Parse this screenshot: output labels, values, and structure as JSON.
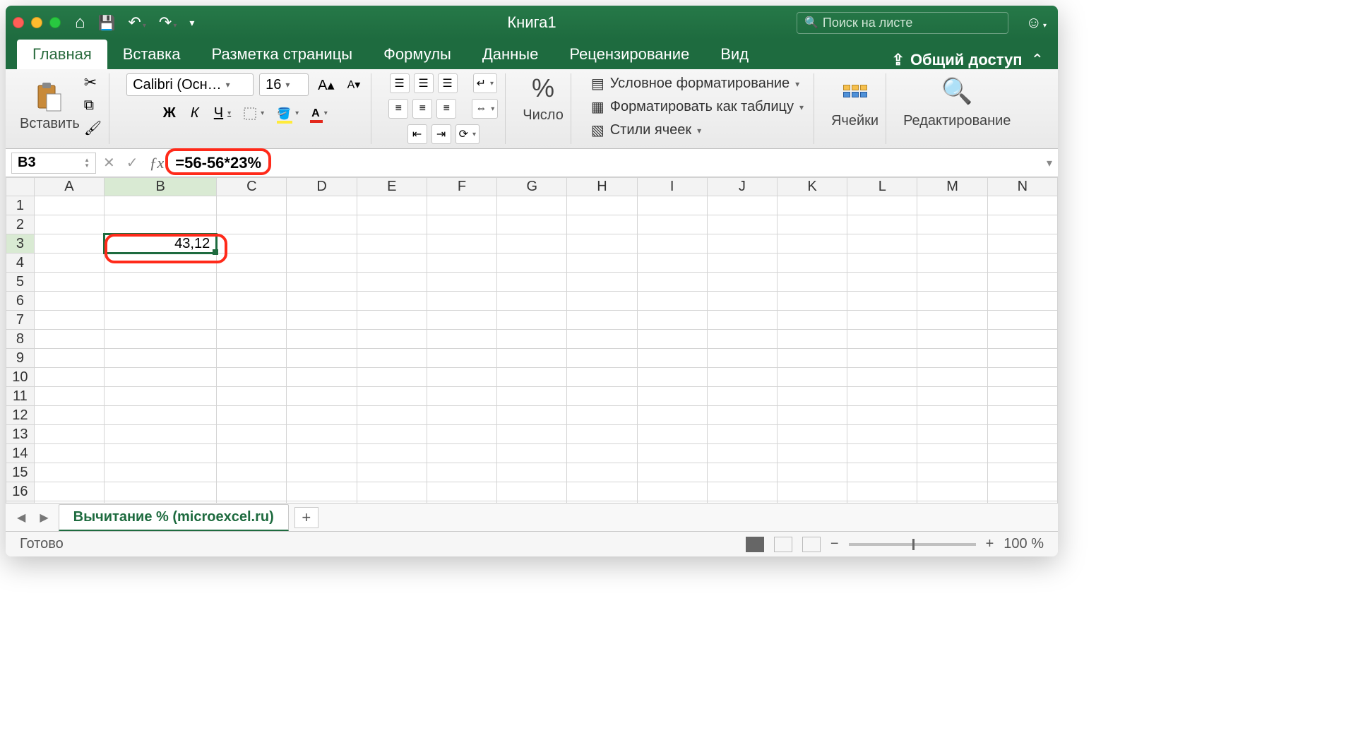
{
  "window": {
    "title": "Книга1"
  },
  "search": {
    "placeholder": "Поиск на листе"
  },
  "tabs": {
    "items": [
      "Главная",
      "Вставка",
      "Разметка страницы",
      "Формулы",
      "Данные",
      "Рецензирование",
      "Вид"
    ],
    "active_index": 0,
    "share": "Общий доступ"
  },
  "ribbon": {
    "paste": "Вставить",
    "font_name": "Calibri (Осн…",
    "font_size": "16",
    "bold": "Ж",
    "italic": "К",
    "underline": "Ч",
    "number_label": "Число",
    "cond_fmt": "Условное форматирование",
    "as_table": "Форматировать как таблицу",
    "cell_styles": "Стили ячеек",
    "cells": "Ячейки",
    "editing": "Редактирование"
  },
  "formula_bar": {
    "name_box": "B3",
    "formula": "=56-56*23%"
  },
  "grid": {
    "columns": [
      "A",
      "B",
      "C",
      "D",
      "E",
      "F",
      "G",
      "H",
      "I",
      "J",
      "K",
      "L",
      "M",
      "N"
    ],
    "rows": 17,
    "active_col": "B",
    "active_row": 3,
    "cells": {
      "B3": "43,12"
    }
  },
  "sheet_tabs": {
    "active": "Вычитание % (microexcel.ru)"
  },
  "status": {
    "ready": "Готово",
    "zoom": "100 %"
  }
}
